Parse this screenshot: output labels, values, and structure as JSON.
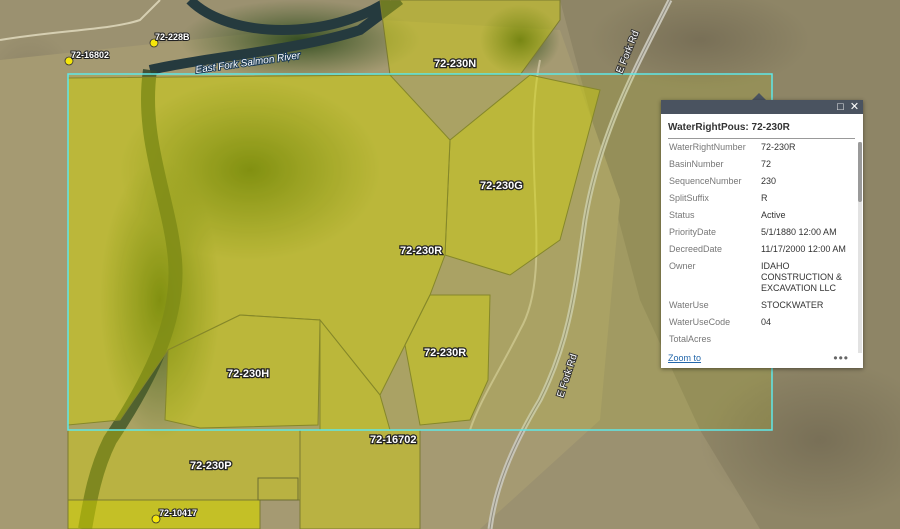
{
  "map": {
    "parcels": [
      {
        "id": "72-230N"
      },
      {
        "id": "72-230G"
      },
      {
        "id": "72-230R"
      },
      {
        "id": "72-230R"
      },
      {
        "id": "72-230H"
      },
      {
        "id": "72-230P"
      },
      {
        "id": "72-16702"
      }
    ],
    "points": [
      {
        "id": "72-228B"
      },
      {
        "id": "72-16802"
      },
      {
        "id": "72-10417"
      }
    ],
    "roads": [
      {
        "name": "E Fork Rd"
      },
      {
        "name": "E Fork Rd"
      }
    ],
    "river": {
      "name": "East Fork Salmon River"
    },
    "colors": {
      "parcel_fill": "#d4d400",
      "selection_outline": "#5fe8e8",
      "point_fill": "#f5e60a"
    }
  },
  "popup": {
    "title": "WaterRightPous: 72-230R",
    "fields": [
      {
        "key": "WaterRightNumber",
        "value": "72-230R"
      },
      {
        "key": "BasinNumber",
        "value": "72"
      },
      {
        "key": "SequenceNumber",
        "value": "230"
      },
      {
        "key": "SplitSuffix",
        "value": "R"
      },
      {
        "key": "Status",
        "value": "Active"
      },
      {
        "key": "PriorityDate",
        "value": "5/1/1880 12:00 AM"
      },
      {
        "key": "DecreedDate",
        "value": "11/17/2000 12:00 AM"
      },
      {
        "key": "Owner",
        "value": "IDAHO CONSTRUCTION & EXCAVATION LLC"
      },
      {
        "key": "WaterUse",
        "value": "STOCKWATER"
      },
      {
        "key": "WaterUseCode",
        "value": "04"
      },
      {
        "key": "TotalAcres",
        "value": ""
      }
    ],
    "zoom_label": "Zoom to",
    "more_label": "•••",
    "maximize_icon": "maximize-icon",
    "close_icon": "close-icon"
  }
}
